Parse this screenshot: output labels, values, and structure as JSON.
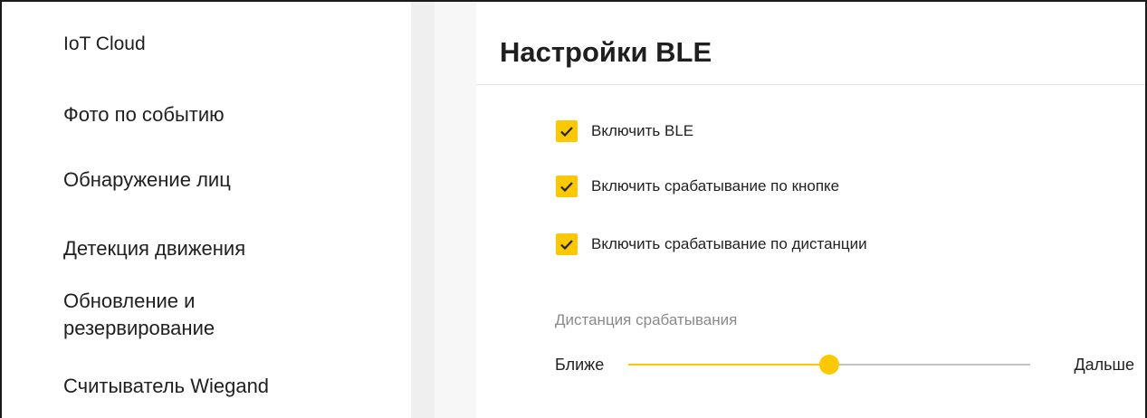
{
  "sidebar": {
    "items": [
      {
        "label": "IoT Cloud"
      },
      {
        "label": "Фото по событию"
      },
      {
        "label": "Обнаружение лиц"
      },
      {
        "label": "Детекция движения"
      },
      {
        "label": "Обновление и резервирование"
      },
      {
        "label": "Считыватель Wiegand"
      }
    ]
  },
  "main": {
    "title": "Настройки BLE",
    "checkboxes": [
      {
        "label": "Включить BLE",
        "checked": true
      },
      {
        "label": "Включить срабатывание по кнопке",
        "checked": true
      },
      {
        "label": "Включить срабатывание по дистанции",
        "checked": true
      }
    ],
    "distance": {
      "label": "Дистанция срабатывания",
      "min_label": "Ближе",
      "max_label": "Дальше",
      "value_fraction": 0.5
    }
  },
  "colors": {
    "accent": "#fcc800",
    "track": "#c4c4c4",
    "muted_text": "#8a8a8a",
    "strip": "#efefef"
  },
  "icons": {
    "checkbox_mark": "check-icon"
  }
}
